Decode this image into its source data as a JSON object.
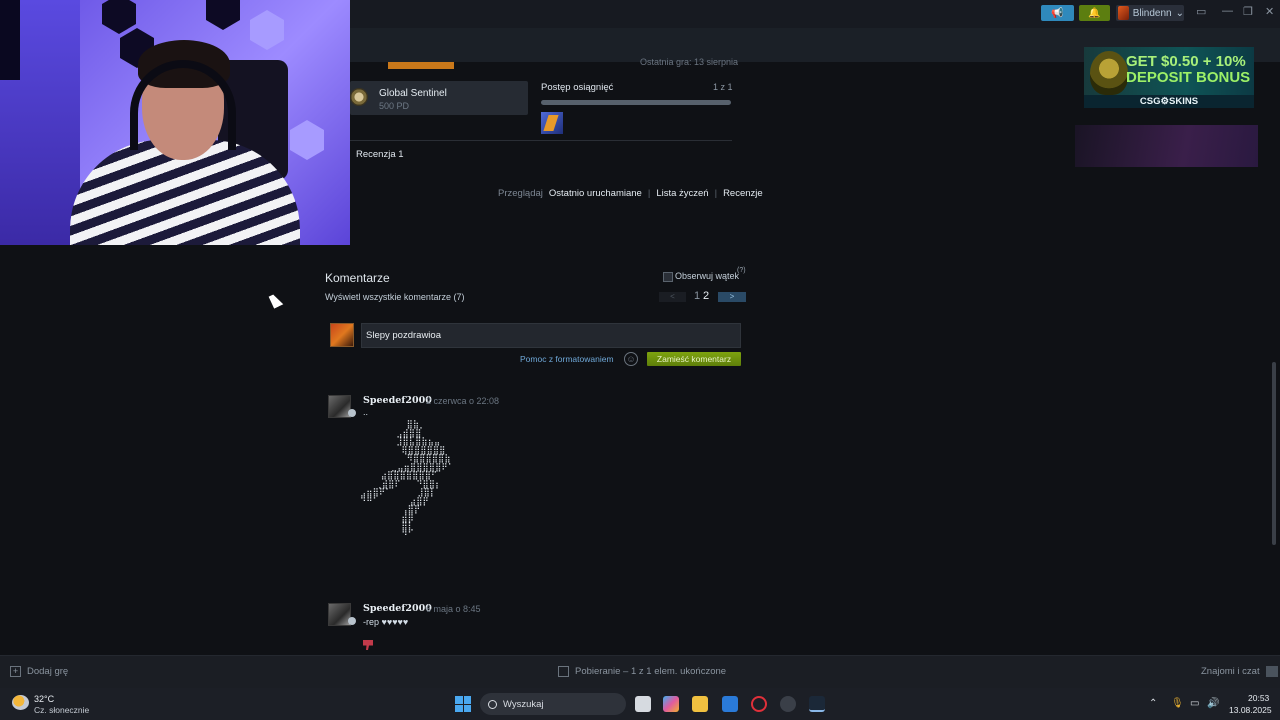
{
  "topbar": {
    "announce_icon": "megaphone-icon",
    "notify_icon": "bell-icon",
    "username": "Blindenn",
    "user_menu_icon": "chevron-down-icon",
    "window_controls": [
      "monitor-icon",
      "minimize-icon",
      "restore-icon",
      "close-icon"
    ]
  },
  "game": {
    "last_played": "Ostatnia gra: 13 sierpnia",
    "badge_name": "Global Sentinel",
    "badge_xp": "500 PD",
    "achievements_label": "Postęp osiągnięć",
    "achievements_count": "1 z 1",
    "achievements_progress": 1.0,
    "reviews": "Recenzja 1"
  },
  "browse": {
    "label": "Przeglądaj",
    "links": [
      "Ostatnio uruchamiane",
      "Lista życzeń",
      "Recenzje"
    ]
  },
  "ads": {
    "ad1_line1": "GET $0.50 + 10%",
    "ad1_line2": "DEPOSIT BONUS",
    "ad1_brand": "CSG⚙SKINS"
  },
  "comments": {
    "title": "Komentarze",
    "show_all": "Wyświetl wszystkie komentarze (7)",
    "subscribe_label": "Obserwuj wątek",
    "subscribe_help": "(?)",
    "pager": {
      "prev": "<",
      "pages": [
        "1",
        "2"
      ],
      "current": "2",
      "next": ">"
    },
    "input_value": "Slepy pozdrawioa",
    "format_help": "Pomoc z formatowaniem",
    "emoji_icon": "smiley-icon",
    "post_button": "Zamieść komentarz",
    "items": [
      {
        "author": "Speedef2000",
        "date": "2 czerwca o 22:08",
        "text": ".."
      },
      {
        "author": "Speedef2000",
        "date": "6 maja o 8:45",
        "text": "-rep ♥♥♥♥♥"
      }
    ],
    "ascii_art": "         ⣿⣷⡀\n       ⣠⣾⣿⣿\n       ⣸⣿⣧⣿⣷⣦⣤\n        ⢿⣿⣿⣿⣿⣿⣿\n         ⠻⣿⣿⣿⣿⣿⣷\n      ⣀⣤⣶⣿⣿⣿⣿⣿⠟⠁\n    ⣴⣿⣿⣿⣿⣿⣿⣿⠋\n   ⢀⣾⣿⠏   ⠙⣿⣿⡆\n⣠⣶⣿⠟⠁     ⣸⣿⡇\n⠙⠛⠁      ⣴⣿⡟\n        ⢠⣿⡟\n        ⣾⡿\n        ⣿⣇\n        ⠙⠁"
  },
  "steambar": {
    "add_game": "Dodaj grę",
    "download": "Pobieranie – 1 z 1 elem. ukończone",
    "friends": "Znajomi i czat"
  },
  "taskbar": {
    "weather_temp": "32°C",
    "weather_desc": "Cz. słonecznie",
    "search_placeholder": "Wyszukaj",
    "time": "20:53",
    "date": "13.08.2025"
  }
}
